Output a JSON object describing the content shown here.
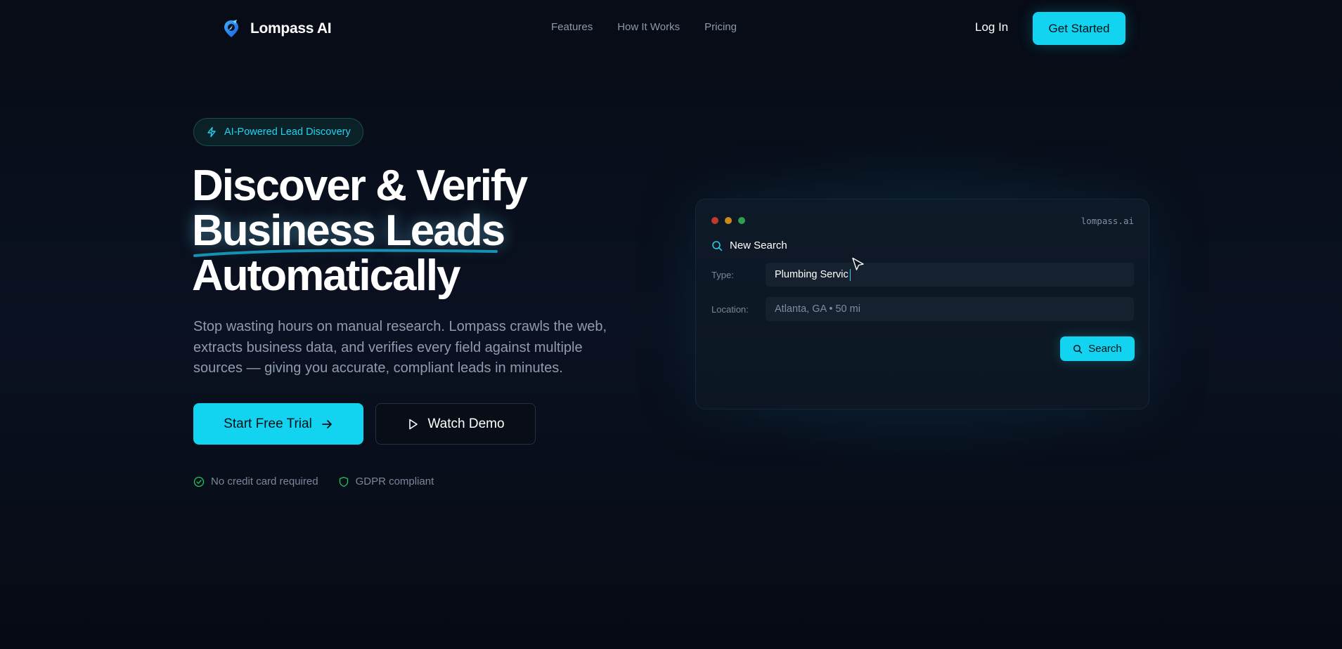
{
  "nav": {
    "brand": "Lompass AI",
    "links": [
      "Features",
      "How It Works",
      "Pricing"
    ],
    "login": "Log In",
    "cta": "Get Started"
  },
  "hero": {
    "badge": "AI-Powered Lead Discovery",
    "headline": [
      "Discover & Verify",
      "Business Leads",
      "Automatically"
    ],
    "subtext": "Stop wasting hours on manual research. Lompass crawls the web, extracts business data, and verifies every field against multiple sources — giving you accurate, compliant leads in minutes.",
    "primary_cta": "Start Free Trial",
    "secondary_cta": "Watch Demo",
    "trust": [
      "No credit card required",
      "GDPR compliant"
    ]
  },
  "search_window": {
    "domain": "lompass.ai",
    "title": "New Search",
    "type_label": "Type:",
    "type_value": "Plumbing Servic",
    "location_label": "Location:",
    "location_value": "Atlanta, GA • 50 mi",
    "search_button": "Search"
  },
  "colors": {
    "accent": "#12d4f0",
    "background": "#070c16",
    "dot_red": "#c0392b",
    "dot_yellow": "#c98a1a",
    "dot_green": "#2e9e4f",
    "trust_green": "#22c55e"
  },
  "icons": {
    "brand": "compass-pin-icon",
    "badge": "lightning-icon",
    "primary_cta": "arrow-right-icon",
    "secondary_cta": "play-icon",
    "trust": [
      "check-circle-icon",
      "shield-icon"
    ],
    "search": "search-icon",
    "pointer": "mouse-pointer-icon"
  }
}
